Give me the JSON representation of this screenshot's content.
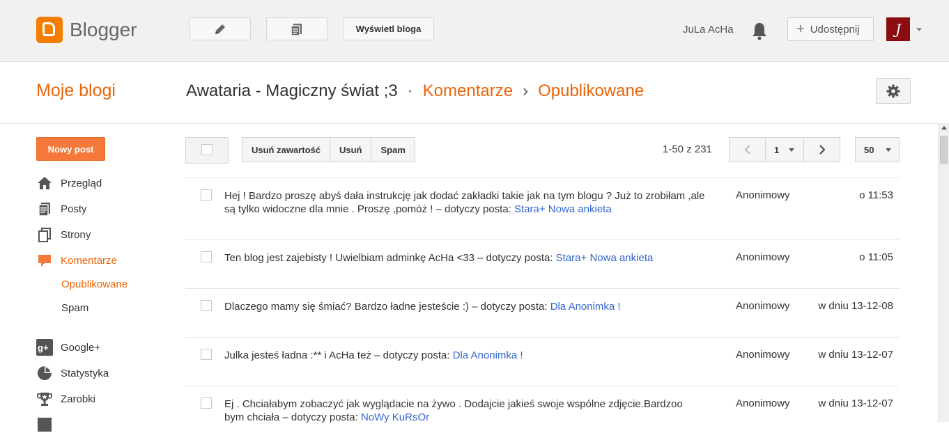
{
  "app": {
    "name": "Blogger"
  },
  "topbar": {
    "view_blog_label": "Wyświetl bloga",
    "user_name": "JuLa AcHa",
    "share_label": "Udostępnij",
    "avatar_letter": "J"
  },
  "header": {
    "my_blogs": "Moje blogi",
    "blog_title": "Awataria - Magiczny świat ;3",
    "sep1": "·",
    "section": "Komentarze",
    "sep2": "›",
    "subsection": "Opublikowane"
  },
  "sidebar": {
    "new_post": "Nowy post",
    "items": [
      {
        "label": "Przegląd",
        "icon": "home-icon"
      },
      {
        "label": "Posty",
        "icon": "posts-icon"
      },
      {
        "label": "Strony",
        "icon": "pages-icon"
      },
      {
        "label": "Komentarze",
        "icon": "comments-icon",
        "active": true
      },
      {
        "label": "Google+",
        "icon": "google-plus-icon"
      },
      {
        "label": "Statystyka",
        "icon": "stats-icon"
      },
      {
        "label": "Zarobki",
        "icon": "trophy-icon"
      }
    ],
    "sub_items": [
      {
        "label": "Opublikowane",
        "active": true
      },
      {
        "label": "Spam"
      }
    ]
  },
  "toolbar": {
    "delete_content": "Usuń zawartość",
    "delete": "Usuń",
    "spam": "Spam",
    "range": "1-50 z 231",
    "page": "1",
    "per_page": "50"
  },
  "comments": [
    {
      "text": "Hej ! Bardzo proszę abyś dała instrukcję jak dodać zakładki takie jak na tym blogu ? Już to zrobiłam ,ale są tylko widoczne dla mnie . Proszę ,pomóż !",
      "post_prefix": " – dotyczy posta: ",
      "post": "Stara+ Nowa ankieta",
      "author": "Anonimowy",
      "date": "o 11:53"
    },
    {
      "text": "Ten blog jest zajebisty ! Uwielbiam adminkę AcHa <33",
      "post_prefix": " – dotyczy posta: ",
      "post": "Stara+ Nowa ankieta",
      "author": "Anonimowy",
      "date": "o 11:05"
    },
    {
      "text": "Dlaczego mamy się śmiać? Bardzo ładne jesteście :)",
      "post_prefix": " – dotyczy posta: ",
      "post": "Dla Anonimka !",
      "author": "Anonimowy",
      "date": "w dniu 13-12-08"
    },
    {
      "text": "Julka jesteś ładna :** i AcHa też",
      "post_prefix": " – dotyczy posta: ",
      "post": "Dla Anonimka !",
      "author": "Anonimowy",
      "date": "w dniu 13-12-07"
    },
    {
      "text": "Ej . Chciałabym zobaczyć jak wyglądacie na żywo . Dodajcie jakieś swoje wspólne zdjęcie.Bardzoo bym chciała",
      "post_prefix": " – dotyczy posta: ",
      "post": "NoWy KuRsOr",
      "author": "Anonimowy",
      "date": "w dniu 13-12-07"
    }
  ]
}
